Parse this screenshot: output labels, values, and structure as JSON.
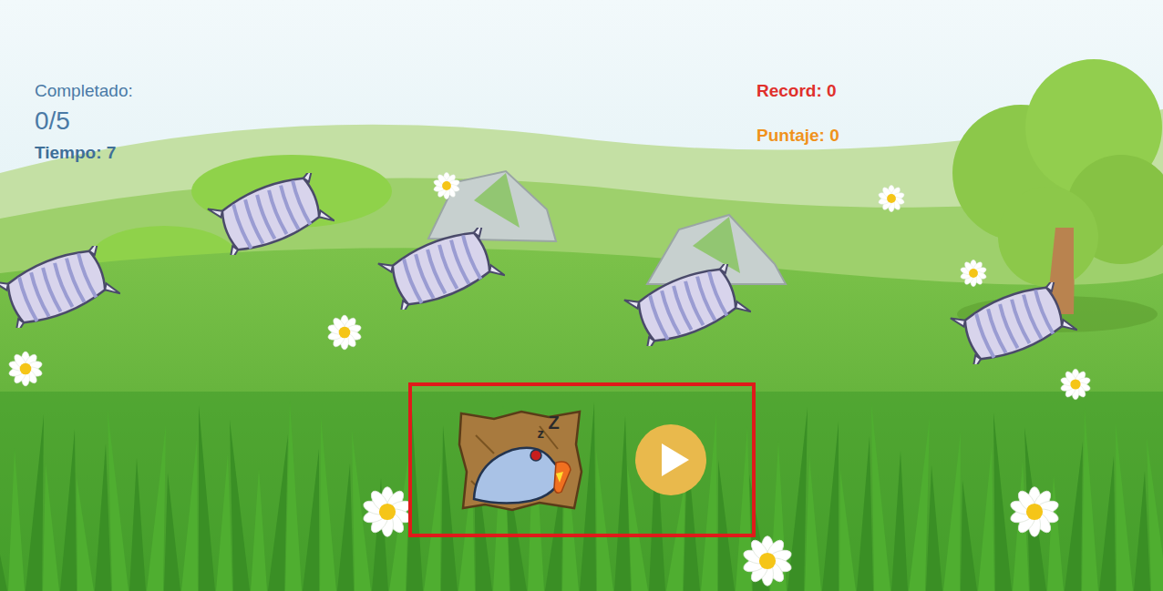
{
  "hud": {
    "completed_label": "Completado:",
    "completed": "0/5",
    "time": "Tiempo: 7",
    "record": "Record: 0",
    "score": "Puntaje: 0"
  },
  "pillows": [
    {
      "hit": false
    },
    {
      "hit": false
    },
    {
      "hit": false
    },
    {
      "hit": false
    },
    {
      "hit": false
    }
  ],
  "tutorial": {
    "highlighted": true,
    "sleep_marks": [
      "z",
      "Z"
    ]
  }
}
